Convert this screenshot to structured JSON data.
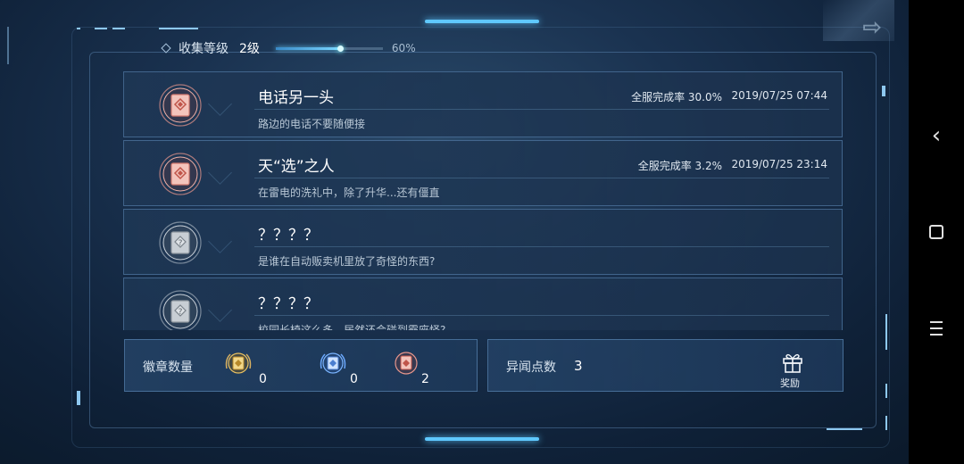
{
  "header": {
    "level_label": "收集等级",
    "level_value": "2级",
    "progress_percent": 60,
    "progress_text": "60%"
  },
  "entries": [
    {
      "title": "电话另一头",
      "completion": "全服完成率 30.0%",
      "date": "2019/07/25 07:44",
      "description": "路边的电话不要随便接",
      "unlocked": true
    },
    {
      "title": "天“选”之人",
      "completion": "全服完成率 3.2%",
      "date": "2019/07/25 23:14",
      "description": "在雷电的洗礼中，除了升华...还有僵直",
      "unlocked": true
    },
    {
      "title": "？？？？",
      "completion": "",
      "date": "",
      "description": "是谁在自动贩卖机里放了奇怪的东西?",
      "unlocked": false
    },
    {
      "title": "？？？？",
      "completion": "",
      "date": "",
      "description": "校园长椅这么多，居然还会碰到霸座怪?",
      "unlocked": false
    }
  ],
  "badges": {
    "label": "徽章数量",
    "gold_count": "0",
    "blue_count": "0",
    "bronze_count": "2"
  },
  "points": {
    "label": "异闻点数",
    "value": "3",
    "reward_label": "奖励"
  },
  "colors": {
    "accent": "#5fc8ff",
    "panel_border": "#6ea0d2",
    "badge_bronze": "#e8968c",
    "badge_gold": "#e8c060",
    "badge_blue": "#6aa8ff"
  },
  "icons": {
    "back": "back-icon",
    "home": "home-icon",
    "menu": "menu-icon",
    "gift": "gift-icon",
    "locked_badge": "locked-badge-icon",
    "unlocked_badge": "unlocked-badge-icon"
  }
}
